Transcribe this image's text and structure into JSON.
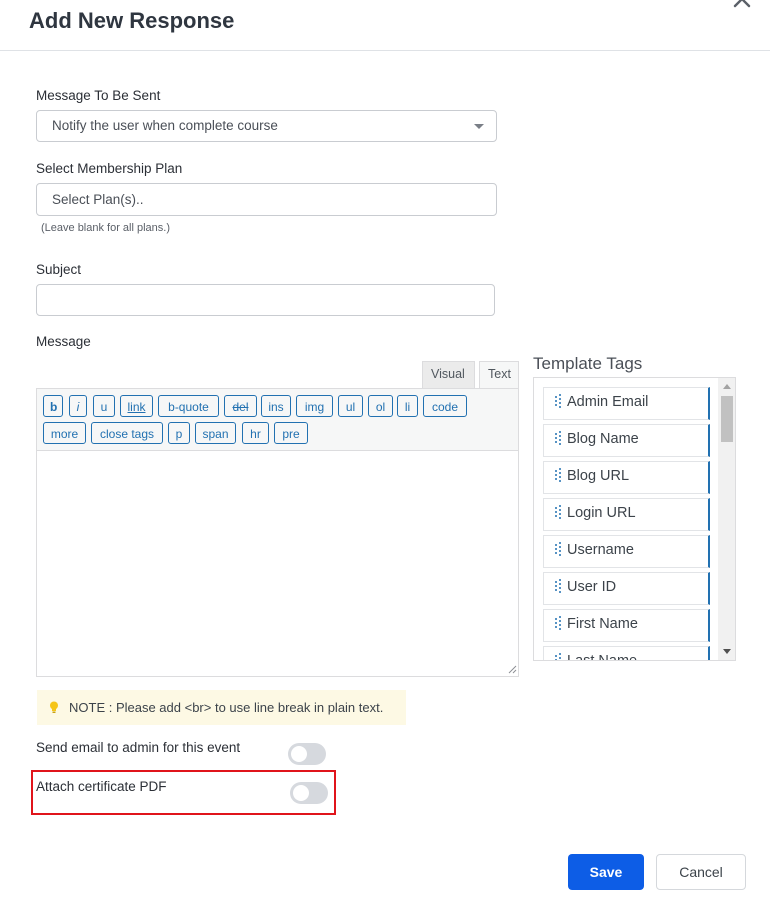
{
  "modal": {
    "title": "Add New Response"
  },
  "message_to_send": {
    "label": "Message To Be Sent",
    "selected": "Notify the user when complete course"
  },
  "membership_plan": {
    "label": "Select Membership Plan",
    "placeholder": "Select Plan(s)..",
    "hint": "(Leave blank for all plans.)"
  },
  "subject": {
    "label": "Subject",
    "value": ""
  },
  "message": {
    "label": "Message",
    "tabs": [
      "Visual",
      "Text"
    ],
    "toolbar_buttons": [
      "b",
      "i",
      "u",
      "link",
      "b-quote",
      "del",
      "ins",
      "img",
      "ul",
      "ol",
      "li",
      "code",
      "more",
      "close tags",
      "p",
      "span",
      "hr",
      "pre"
    ],
    "value": ""
  },
  "template_tags": {
    "title": "Template Tags",
    "items": [
      "Admin Email",
      "Blog Name",
      "Blog URL",
      "Login URL",
      "Username",
      "User ID",
      "First Name",
      "Last Name"
    ]
  },
  "note": {
    "text": "NOTE : Please add <br> to use line break in plain text."
  },
  "toggles": {
    "send_admin_email": {
      "label": "Send email to admin for this event",
      "on": false
    },
    "attach_certificate": {
      "label": "Attach certificate PDF",
      "on": false
    }
  },
  "footer": {
    "save_label": "Save",
    "cancel_label": "Cancel"
  },
  "colors": {
    "primary": "#0d5de6",
    "link_blue": "#2271b1",
    "highlight_red": "#e0141b",
    "note_bg": "#fdf9e4"
  }
}
